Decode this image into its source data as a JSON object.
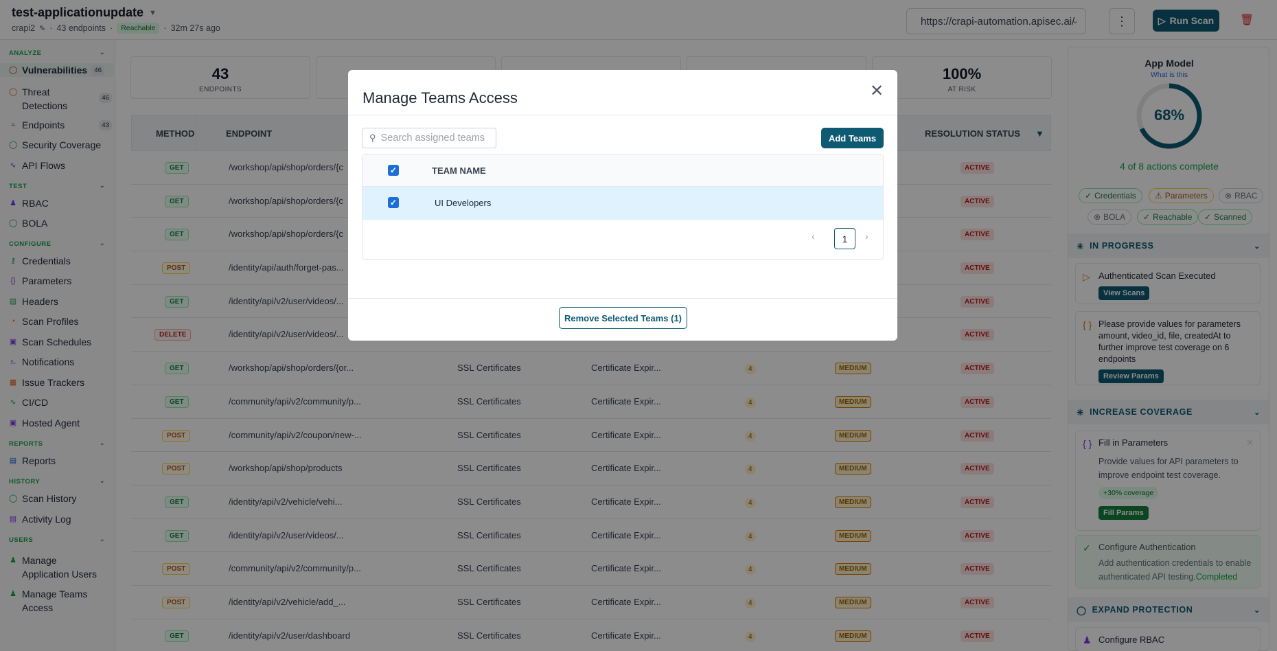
{
  "header": {
    "title": "test-applicationupdate",
    "user": "crapi2",
    "endpoints": "43 endpoints",
    "status": "Reachable",
    "ago": "32m 27s ago",
    "url": "https://crapi-automation.apisec.ai/",
    "run_scan": "Run Scan"
  },
  "sidebar": {
    "analyze": "ANALYZE",
    "test": "TEST",
    "configure": "CONFIGURE",
    "reports": "REPORTS",
    "history": "HISTORY",
    "users": "USERS",
    "vulnerabilities": "Vulnerabilities",
    "vulnerabilities_count": "46",
    "threat1": "Threat",
    "threat2": "Detections",
    "threat_count": "46",
    "endpoints": "Endpoints",
    "endpoints_count": "43",
    "security_coverage": "Security Coverage",
    "api_flows": "API Flows",
    "rbac": "RBAC",
    "bola": "BOLA",
    "credentials": "Credentials",
    "parameters": "Parameters",
    "headers": "Headers",
    "scan_profiles": "Scan Profiles",
    "scan_schedules": "Scan Schedules",
    "notifications": "Notifications",
    "issue_trackers": "Issue Trackers",
    "cicd": "CI/CD",
    "hosted_agent": "Hosted Agent",
    "reports_item": "Reports",
    "scan_history": "Scan History",
    "activity_log": "Activity Log",
    "manage_app_users1": "Manage",
    "manage_app_users2": "Application Users",
    "manage_teams1": "Manage Teams",
    "manage_teams2": "Access"
  },
  "stats": {
    "s1_value": "43",
    "s1_label": "ENDPOINTS",
    "s5_value": "100%",
    "s5_label": "AT RISK"
  },
  "table": {
    "col_method": "METHOD",
    "col_endpoint": "ENDPOINT",
    "col_resolution": "RESOLUTION STATUS",
    "rows": [
      {
        "method": "GET",
        "endpoint": "/workshop/api/shop/orders/{c",
        "category": "",
        "name": "",
        "count": "",
        "severity": "",
        "status": "ACTIVE"
      },
      {
        "method": "GET",
        "endpoint": "/workshop/api/shop/orders/{c",
        "category": "",
        "name": "",
        "count": "",
        "severity": "",
        "status": "ACTIVE"
      },
      {
        "method": "GET",
        "endpoint": "/workshop/api/shop/orders/{c",
        "category": "",
        "name": "",
        "count": "",
        "severity": "",
        "status": "ACTIVE"
      },
      {
        "method": "POST",
        "endpoint": "/identity/api/auth/forget-pas...",
        "category": "",
        "name": "",
        "count": "",
        "severity": "",
        "status": "ACTIVE"
      },
      {
        "method": "GET",
        "endpoint": "/identity/api/v2/user/videos/...",
        "category": "",
        "name": "",
        "count": "",
        "severity": "",
        "status": "ACTIVE"
      },
      {
        "method": "DELETE",
        "endpoint": "/identity/api/v2/user/videos/...",
        "category": "",
        "name": "",
        "count": "",
        "severity": "",
        "status": "ACTIVE"
      },
      {
        "method": "GET",
        "endpoint": "/workshop/api/shop/orders/{or...",
        "category": "SSL Certificates",
        "name": "Certificate Expir...",
        "count": "4",
        "severity": "MEDIUM",
        "status": "ACTIVE"
      },
      {
        "method": "GET",
        "endpoint": "/community/api/v2/community/p...",
        "category": "SSL Certificates",
        "name": "Certificate Expir...",
        "count": "4",
        "severity": "MEDIUM",
        "status": "ACTIVE"
      },
      {
        "method": "POST",
        "endpoint": "/community/api/v2/coupon/new-...",
        "category": "SSL Certificates",
        "name": "Certificate Expir...",
        "count": "4",
        "severity": "MEDIUM",
        "status": "ACTIVE"
      },
      {
        "method": "POST",
        "endpoint": "/workshop/api/shop/products",
        "category": "SSL Certificates",
        "name": "Certificate Expir...",
        "count": "4",
        "severity": "MEDIUM",
        "status": "ACTIVE"
      },
      {
        "method": "GET",
        "endpoint": "/identity/api/v2/vehicle/vehi...",
        "category": "SSL Certificates",
        "name": "Certificate Expir...",
        "count": "4",
        "severity": "MEDIUM",
        "status": "ACTIVE"
      },
      {
        "method": "GET",
        "endpoint": "/identity/api/v2/user/videos/...",
        "category": "SSL Certificates",
        "name": "Certificate Expir...",
        "count": "4",
        "severity": "MEDIUM",
        "status": "ACTIVE"
      },
      {
        "method": "POST",
        "endpoint": "/community/api/v2/community/p...",
        "category": "SSL Certificates",
        "name": "Certificate Expir...",
        "count": "4",
        "severity": "MEDIUM",
        "status": "ACTIVE"
      },
      {
        "method": "POST",
        "endpoint": "/identity/api/v2/vehicle/add_...",
        "category": "SSL Certificates",
        "name": "Certificate Expir...",
        "count": "4",
        "severity": "MEDIUM",
        "status": "ACTIVE"
      },
      {
        "method": "GET",
        "endpoint": "/identity/api/v2/user/dashboard",
        "category": "SSL Certificates",
        "name": "Certificate Expir...",
        "count": "4",
        "severity": "MEDIUM",
        "status": "ACTIVE"
      }
    ]
  },
  "panel": {
    "title": "App Model",
    "what": "What is this",
    "percent": "68%",
    "percent_value": 0.68,
    "complete": "4 of 8 actions complete",
    "chips": {
      "credentials": "Credentials",
      "parameters": "Parameters",
      "rbac": "RBAC",
      "bola": "BOLA",
      "reachable": "Reachable",
      "scanned": "Scanned"
    },
    "in_progress": "IN PROGRESS",
    "auth_scan": "Authenticated Scan Executed",
    "view_scans": "View Scans",
    "params_msg": "Please provide values for parameters amount, video_id, file, createdAt to further improve test coverage on 6 endpoints",
    "review_params": "Review Params",
    "increase_coverage": "INCREASE COVERAGE",
    "fill_title": "Fill in Parameters",
    "fill_desc": "Provide values for API parameters to improve endpoint test coverage.",
    "coverage_badge": "+30% coverage",
    "fill_params": "Fill Params",
    "config_auth": "Configure Authentication",
    "config_auth_desc": "Add authentication credentials to enable authenticated API testing.",
    "completed": "Completed",
    "expand_protection": "EXPAND PROTECTION",
    "config_rbac": "Configure RBAC"
  },
  "modal": {
    "title": "Manage Teams Access",
    "search_placeholder": "Search assigned teams",
    "add_teams": "Add Teams",
    "col_team_name": "TEAM NAME",
    "team_row": "UI Developers",
    "page": "1",
    "remove_btn": "Remove Selected Teams (1)"
  }
}
